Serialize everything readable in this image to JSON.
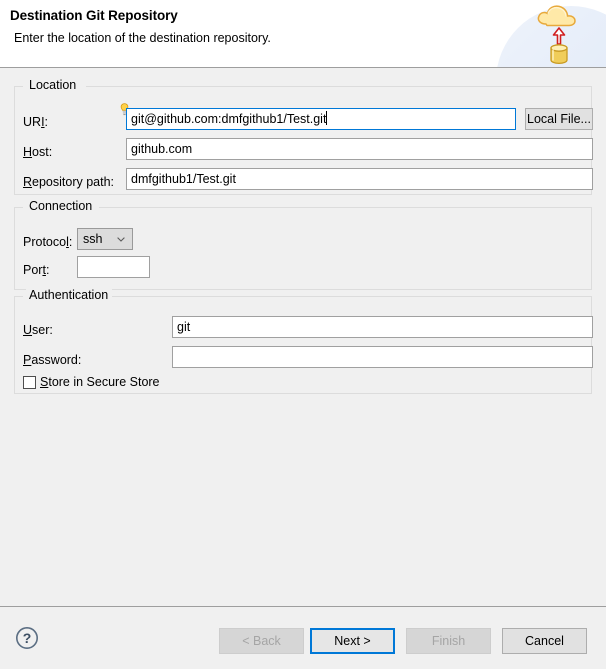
{
  "header": {
    "title": "Destination Git Repository",
    "subtitle": "Enter the location of the destination repository.",
    "icon": "cloud-upload-database-icon"
  },
  "location": {
    "legend": "Location",
    "uri": {
      "label_before": "UR",
      "label_mnemonic": "I",
      "label_after": ":",
      "value": "git@github.com:dmfgithub1/Test.git",
      "decoration_icon": "lightbulb-hint-icon",
      "focused": true
    },
    "host": {
      "label_mnemonic": "H",
      "label_after": "ost:",
      "value": "github.com"
    },
    "repository_path": {
      "label_mnemonic": "R",
      "label_after": "epository path:",
      "value": "dmfgithub1/Test.git"
    },
    "local_file_button": "Local File..."
  },
  "connection": {
    "legend": "Connection",
    "protocol": {
      "label_before": "Protoco",
      "label_mnemonic": "l",
      "label_after": ":",
      "value": "ssh",
      "options": [
        "ssh"
      ],
      "chevron_icon": "chevron-down-icon"
    },
    "port": {
      "label_before": "Por",
      "label_mnemonic": "t",
      "label_after": ":",
      "value": ""
    }
  },
  "authentication": {
    "legend": "Authentication",
    "user": {
      "label_mnemonic": "U",
      "label_after": "ser:",
      "value": "git"
    },
    "password": {
      "label_mnemonic": "P",
      "label_after": "assword:",
      "value": ""
    },
    "store_secure": {
      "label_mnemonic": "S",
      "label_after": "tore in Secure Store",
      "checked": false
    }
  },
  "footer": {
    "help_icon": "help-question-icon",
    "back_button": "< Back",
    "next_button": "Next >",
    "finish_button": "Finish",
    "cancel_button": "Cancel",
    "back_enabled": false,
    "finish_enabled": false,
    "next_is_default": true
  },
  "colors": {
    "focus_blue": "#0078d7",
    "body_bg": "#f0f0f0",
    "header_bg": "#ffffff",
    "group_border": "#dcdcdc"
  }
}
